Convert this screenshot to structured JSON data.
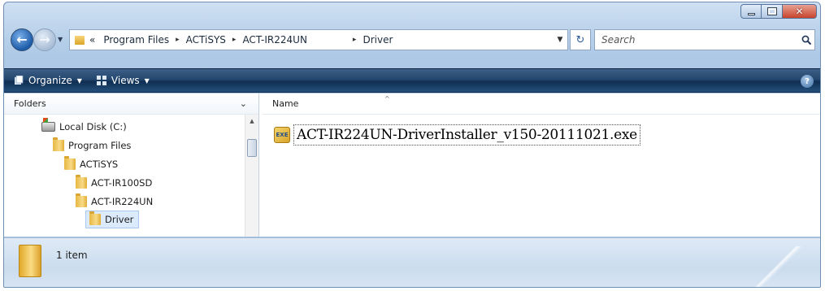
{
  "window": {
    "caption": {
      "minimize_icon": "minimize-icon",
      "maximize_icon": "maximize-icon",
      "close_glyph": "✕"
    }
  },
  "navigation": {
    "back_glyph": "←",
    "forward_glyph": "→",
    "recent_glyph": "▼"
  },
  "address_bar": {
    "overflow": "«",
    "crumbs": [
      "Program Files",
      "ACTiSYS",
      "ACT-IR224UN",
      "Driver"
    ],
    "separator": "▸",
    "dropdown_glyph": "▼"
  },
  "refresh_glyph": "↻",
  "search": {
    "placeholder": "Search"
  },
  "command_bar": {
    "organize_label": "Organize",
    "views_label": "Views",
    "caret": "▼",
    "help_glyph": "?"
  },
  "navigation_pane": {
    "header": "Folders",
    "collapse_glyph": "⌄",
    "items": [
      {
        "label": "Local Disk (C:)",
        "icon": "drive-icon"
      },
      {
        "label": "Program Files",
        "icon": "folder-icon"
      },
      {
        "label": "ACTiSYS",
        "icon": "folder-icon"
      },
      {
        "label": "ACT-IR100SD",
        "icon": "folder-icon"
      },
      {
        "label": "ACT-IR224UN",
        "icon": "folder-icon"
      },
      {
        "label": "Driver",
        "icon": "folder-icon",
        "selected": true
      }
    ]
  },
  "file_list": {
    "column_name": "Name",
    "sort_glyph": "^",
    "files": [
      {
        "name": "ACT-IR224UN-DriverInstaller_v150-20111021.exe",
        "icon": "installer-exe-icon"
      }
    ]
  },
  "details_pane": {
    "item_count": "1 item"
  }
}
